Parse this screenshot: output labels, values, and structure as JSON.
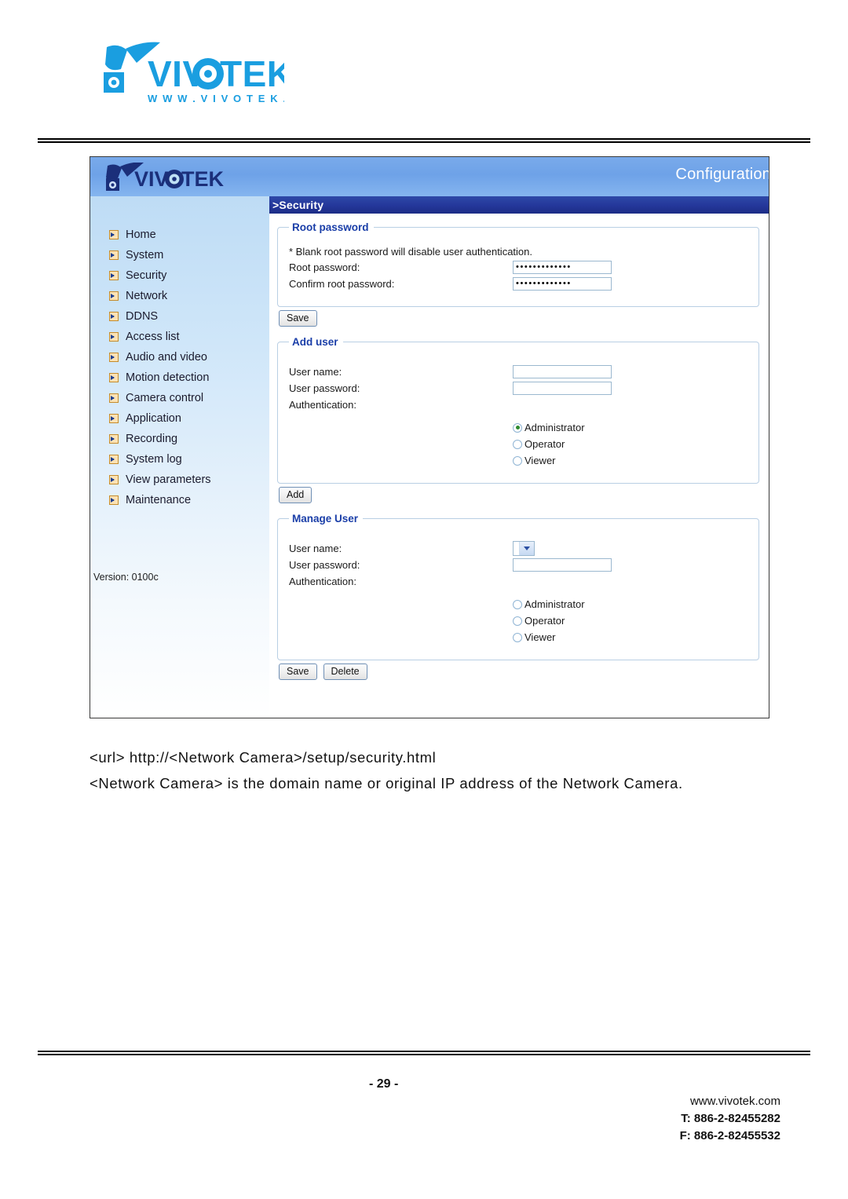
{
  "page": {
    "brand_logo_alt": "VIVOTEK",
    "brand_wordmark": "VIVOTEK",
    "brand_url_strip": "W W W . V I V O T E K . C O M"
  },
  "device_window": {
    "header": {
      "logo_label": "VIVOTEK",
      "right_label": "Configuration"
    },
    "breadcrumb": ">Security",
    "sidebar": {
      "items": [
        {
          "label": "Home"
        },
        {
          "label": "System"
        },
        {
          "label": "Security"
        },
        {
          "label": "Network"
        },
        {
          "label": "DDNS"
        },
        {
          "label": "Access list"
        },
        {
          "label": "Audio and video"
        },
        {
          "label": "Motion detection"
        },
        {
          "label": "Camera control"
        },
        {
          "label": "Application"
        },
        {
          "label": "Recording"
        },
        {
          "label": "System log"
        },
        {
          "label": "View parameters"
        },
        {
          "label": "Maintenance"
        }
      ],
      "version": "Version: 0100c"
    },
    "root_password": {
      "legend": "Root password",
      "note": "* Blank root password will disable user authentication.",
      "root_password_label": "Root password:",
      "root_password_value": "•••••••••••••",
      "confirm_label": "Confirm root password:",
      "confirm_value": "•••••••••••••",
      "save_label": "Save"
    },
    "add_user": {
      "legend": "Add user",
      "user_name_label": "User name:",
      "user_name_value": "",
      "user_password_label": "User password:",
      "user_password_value": "",
      "authentication_label": "Authentication:",
      "options": [
        {
          "label": "Administrator",
          "selected": true
        },
        {
          "label": "Operator",
          "selected": false
        },
        {
          "label": "Viewer",
          "selected": false
        }
      ],
      "add_label": "Add"
    },
    "manage_user": {
      "legend": "Manage User",
      "user_name_label": "User name:",
      "user_name_value": "",
      "user_password_label": "User password:",
      "user_password_value": "",
      "authentication_label": "Authentication:",
      "options": [
        {
          "label": "Administrator",
          "selected": false
        },
        {
          "label": "Operator",
          "selected": false
        },
        {
          "label": "Viewer",
          "selected": false
        }
      ],
      "save_label": "Save",
      "delete_label": "Delete"
    }
  },
  "caption": {
    "line1": "<url> http://<Network Camera>/setup/security.html",
    "line2": "<Network Camera> is the domain name or original IP address of the Network Camera."
  },
  "footer": {
    "page_number": "- 29 -",
    "website": "www.vivotek.com",
    "phone": "T: 886-2-82455282",
    "fax": "F: 886-2-82455532"
  },
  "colors": {
    "header_blue": "#6ea2e8",
    "crumb_blue": "#24379a",
    "legend_blue": "#1a3ea8",
    "brand_cyan": "#1a9ee0",
    "radio_green": "#2e8b30",
    "menu_icon_tan": "#fbe2b4"
  }
}
